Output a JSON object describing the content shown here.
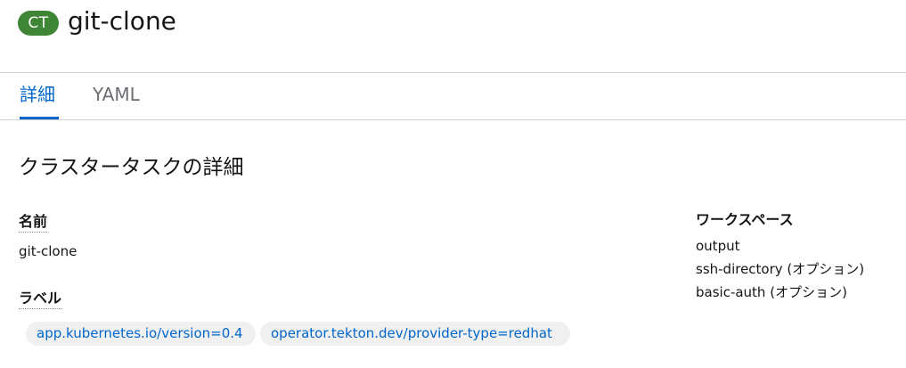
{
  "header": {
    "kind_badge": "CT",
    "title": "git-clone"
  },
  "tabs": [
    {
      "label": "詳細",
      "active": true
    },
    {
      "label": "YAML",
      "active": false
    }
  ],
  "details": {
    "section_title": "クラスタータスクの詳細",
    "name_label": "名前",
    "name_value": "git-clone",
    "labels_label": "ラベル",
    "labels": [
      "app.kubernetes.io/version=0.4",
      "operator.tekton.dev/provider-type=redhat"
    ],
    "workspaces_label": "ワークスペース",
    "workspaces": [
      {
        "name": "output",
        "optional": ""
      },
      {
        "name": "ssh-directory",
        "optional": " (オプション)"
      },
      {
        "name": "basic-auth",
        "optional": " (オプション)"
      }
    ]
  },
  "colors": {
    "badge": "#3e8635",
    "link": "#0066cc",
    "active_tab": "#0066cc",
    "chip_bg": "#f0f0f0"
  }
}
